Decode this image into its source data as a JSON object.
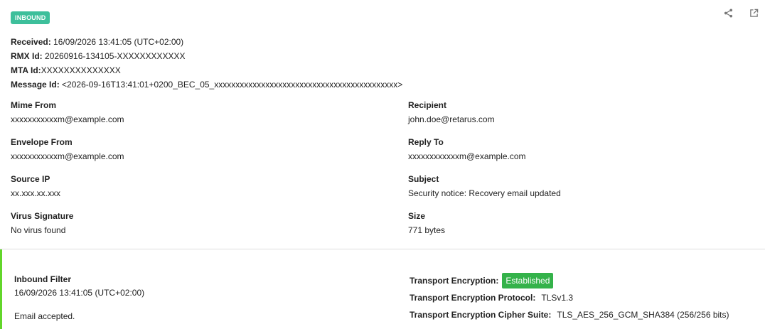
{
  "badge": "INBOUND",
  "icons": {
    "share": "share-icon",
    "open_external": "external-link-icon"
  },
  "meta": {
    "received_label": "Received:",
    "received_value": "16/09/2026 13:41:05 (UTC+02:00)",
    "rmx_label": "RMX Id:",
    "rmx_value": "20260916-134105-XXXXXXXXXXXX",
    "mta_label": "MTA Id:",
    "mta_value": "XXXXXXXXXXXXXX",
    "message_label": "Message Id:",
    "message_value": "<2026-09-16T13:41:01+0200_BEC_05_xxxxxxxxxxxxxxxxxxxxxxxxxxxxxxxxxxxxxxxxxxx>"
  },
  "fields": {
    "mime_from": {
      "label": "Mime From",
      "value": "xxxxxxxxxxxm@example.com"
    },
    "recipient": {
      "label": "Recipient",
      "value": "john.doe@retarus.com"
    },
    "envelope_from": {
      "label": "Envelope From",
      "value": "xxxxxxxxxxxm@example.com"
    },
    "reply_to": {
      "label": "Reply To",
      "value": "xxxxxxxxxxxxm@example.com"
    },
    "source_ip": {
      "label": "Source IP",
      "value": "xx.xxx.xx.xxx"
    },
    "subject": {
      "label": "Subject",
      "value": "Security notice: Recovery email updated"
    },
    "virus_signature": {
      "label": "Virus Signature",
      "value": "No virus found"
    },
    "size": {
      "label": "Size",
      "value": "771 bytes"
    }
  },
  "filter": {
    "title": "Inbound Filter",
    "time": "16/09/2026 13:41:05 (UTC+02:00)",
    "result": "Email accepted.",
    "accent_color": "#62d62a"
  },
  "transport": {
    "encryption_label": "Transport Encryption:",
    "encryption_value": "Established",
    "protocol_label": "Transport Encryption Protocol:",
    "protocol_value": "TLSv1.3",
    "cipher_label": "Transport Encryption Cipher Suite:",
    "cipher_value": "TLS_AES_256_GCM_SHA384 (256/256 bits)"
  },
  "colors": {
    "badge": "#3dbf9b",
    "established": "#34b24a"
  }
}
